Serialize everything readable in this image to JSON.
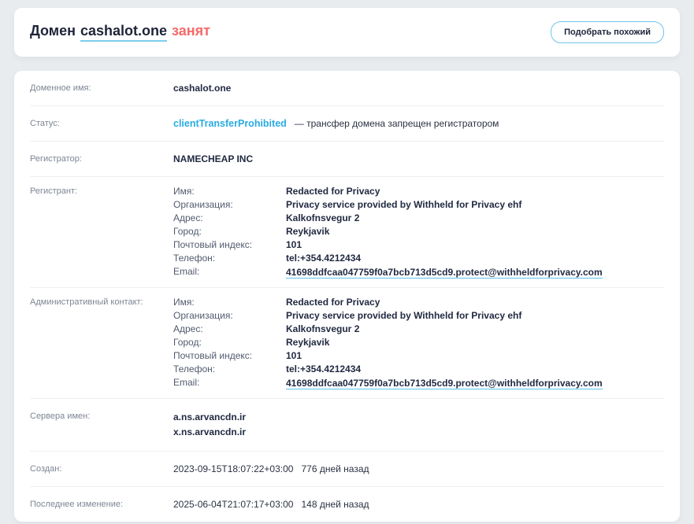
{
  "header": {
    "title_prefix": "Домен",
    "domain": "cashalot.one",
    "status_word": "занят",
    "similar_button": "Подобрать похожий"
  },
  "whois": {
    "domain_name": {
      "label": "Доменное имя:",
      "value": "cashalot.one"
    },
    "status": {
      "label": "Статус:",
      "value": "clientTransferProhibited",
      "note": "— трансфер домена запрещен регистратором"
    },
    "registrar": {
      "label": "Регистратор:",
      "value": "NAMECHEAP INC"
    },
    "registrant": {
      "label": "Регистрант:",
      "fields": [
        {
          "label": "Имя:",
          "value": "Redacted for Privacy"
        },
        {
          "label": "Организация:",
          "value": "Privacy service provided by Withheld for Privacy ehf"
        },
        {
          "label": "Адрес:",
          "value": "Kalkofnsvegur 2"
        },
        {
          "label": "Город:",
          "value": "Reykjavik"
        },
        {
          "label": "Почтовый индекс:",
          "value": "101"
        },
        {
          "label": "Телефон:",
          "value": "tel:+354.4212434"
        },
        {
          "label": "Email:",
          "value": "41698ddfcaa047759f0a7bcb713d5cd9.protect@withheldforprivacy.com"
        }
      ]
    },
    "admin_contact": {
      "label": "Административный контакт:",
      "fields": [
        {
          "label": "Имя:",
          "value": "Redacted for Privacy"
        },
        {
          "label": "Организация:",
          "value": "Privacy service provided by Withheld for Privacy ehf"
        },
        {
          "label": "Адрес:",
          "value": "Kalkofnsvegur 2"
        },
        {
          "label": "Город:",
          "value": "Reykjavik"
        },
        {
          "label": "Почтовый индекс:",
          "value": "101"
        },
        {
          "label": "Телефон:",
          "value": "tel:+354.4212434"
        },
        {
          "label": "Email:",
          "value": "41698ddfcaa047759f0a7bcb713d5cd9.protect@withheldforprivacy.com"
        }
      ]
    },
    "nameservers": {
      "label": "Сервера имен:",
      "values": [
        "a.ns.arvancdn.ir",
        "x.ns.arvancdn.ir"
      ]
    },
    "created": {
      "label": "Создан:",
      "value": "2023-09-15T18:07:22+03:00",
      "ago": "776 дней назад"
    },
    "updated": {
      "label": "Последнее изменение:",
      "value": "2025-06-04T21:07:17+03:00",
      "ago": "148 дней назад"
    }
  },
  "colors": {
    "page_bg": "#e8ecef",
    "accent_blue": "#29abe2",
    "status_red": "#f56a6a",
    "text_dark": "#212a42",
    "label_muted": "#7d8694",
    "divider": "#edf0f4",
    "button_border": "#70c5eb"
  }
}
